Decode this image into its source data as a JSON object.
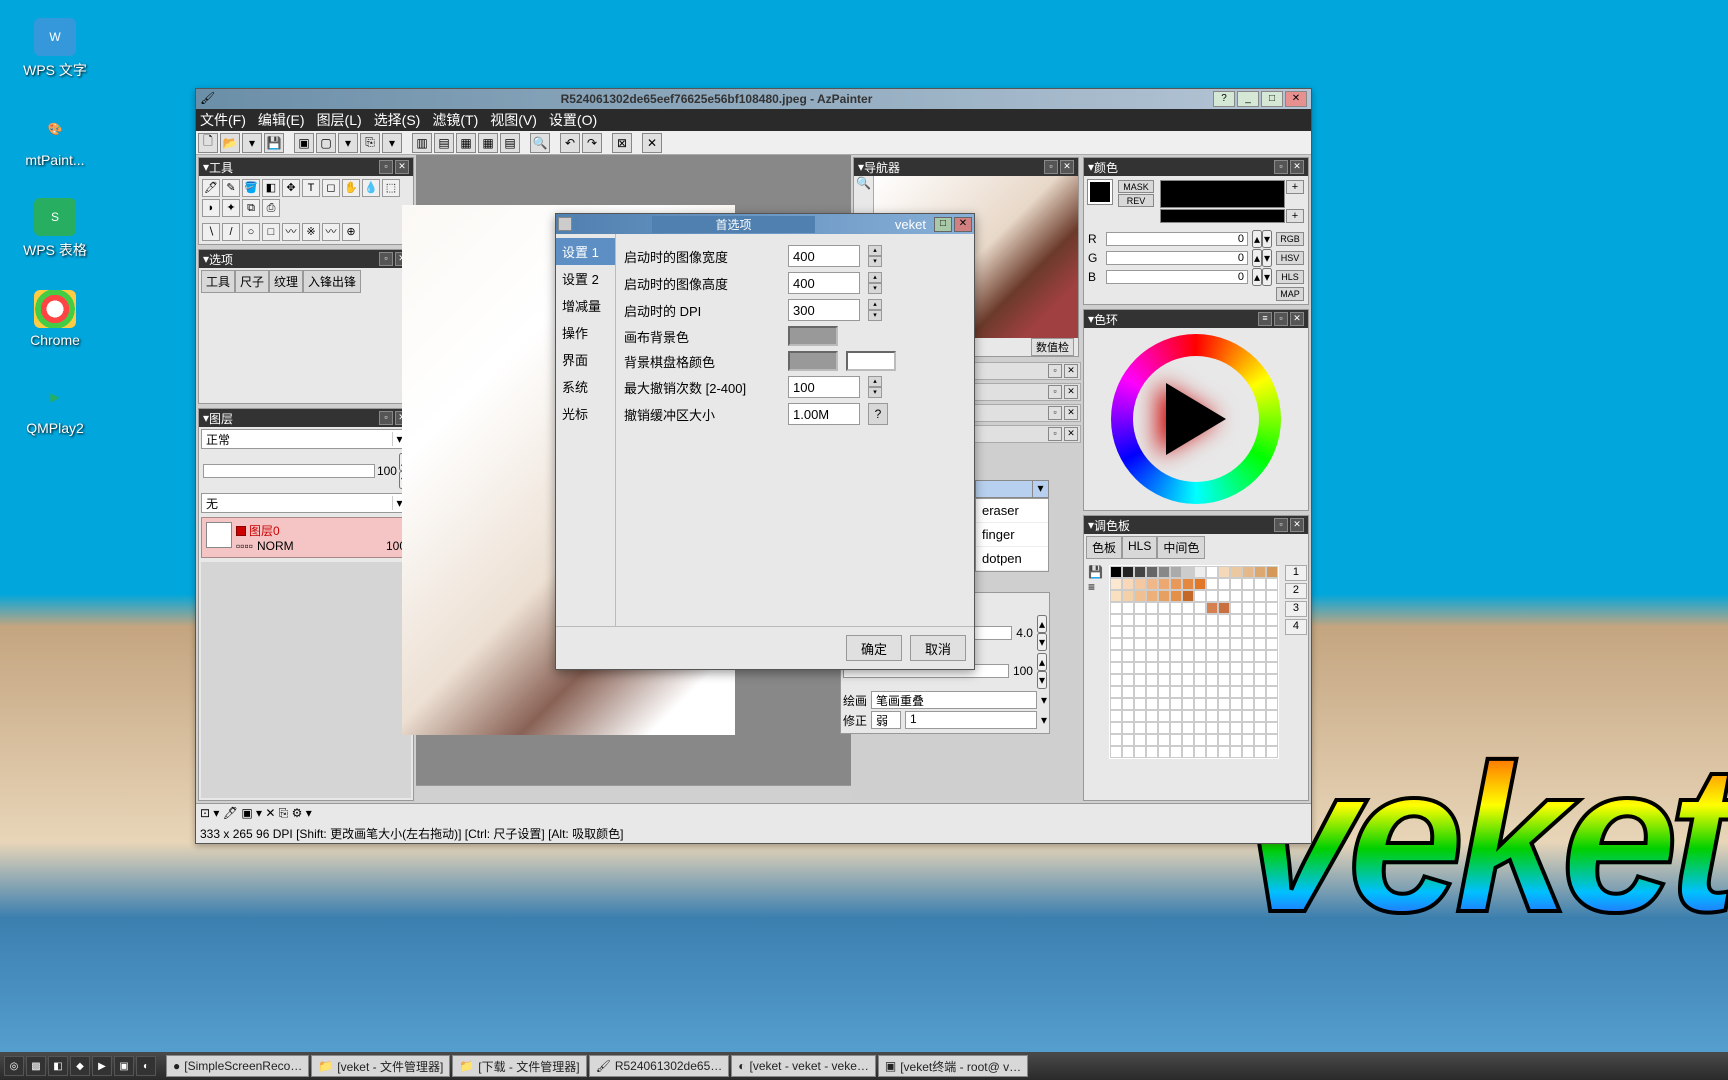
{
  "desktop": {
    "brand": "veket",
    "icons": [
      {
        "label": "WPS 文字",
        "icon": "W",
        "bg": "#3498db"
      },
      {
        "label": "mtPaint...",
        "icon": "🎨",
        "bg": "#333"
      },
      {
        "label": "WPS 表格",
        "icon": "S",
        "bg": "#27ae60"
      },
      {
        "label": "Chrome",
        "icon": "◐",
        "bg": "#fff"
      },
      {
        "label": "QMPlay2",
        "icon": "▶",
        "bg": "#27ae60"
      }
    ]
  },
  "window": {
    "title": "R524061302de65eef76625e56bf108480.jpeg - AzPainter",
    "menu": [
      "文件(F)",
      "编辑(E)",
      "图层(L)",
      "选择(S)",
      "滤镜(T)",
      "视图(V)",
      "设置(O)"
    ]
  },
  "panels": {
    "tools": "工具",
    "options": "选项",
    "option_tabs": [
      "工具",
      "尺子",
      "纹理",
      "入锋出锋"
    ],
    "layers": "图层",
    "layer_mode": "正常",
    "layer_mask": "无",
    "layer_opacity": "100",
    "layer0": {
      "name": "图层0",
      "norm": "NORM",
      "val": "100"
    },
    "nav": "导航器",
    "nav_btn": "数值检",
    "color": "颜色",
    "color_btns": [
      "MASK",
      "REV"
    ],
    "rgb": {
      "R": "0",
      "G": "0",
      "B": "0",
      "modes": [
        "RGB",
        "HSV",
        "HLS",
        "MAP"
      ]
    },
    "wheel": "色环",
    "palette": "调色板",
    "palette_tabs": [
      "色板",
      "HLS",
      "中间色"
    ],
    "palette_ids": [
      "1",
      "2",
      "3",
      "4"
    ]
  },
  "brush_list": [
    "eraser",
    "finger",
    "dotpen"
  ],
  "brush_settings": {
    "size_val": "4.0",
    "other_val": "100",
    "draw_label": "绘画",
    "draw_val": "笔画重叠",
    "fix_label": "修正",
    "fix_mode": "弱",
    "fix_val": "1"
  },
  "status": {
    "row1_icons": "",
    "row2": "333 x  265  96 DPI  [Shift: 更改画笔大小(左右拖动)]  [Ctrl: 尺子设置]  [Alt: 吸取颜色]"
  },
  "pref": {
    "title": "首选项",
    "brand": "veket",
    "tabs": [
      "设置 1",
      "设置 2",
      "增减量",
      "操作",
      "界面",
      "系统",
      "光标"
    ],
    "active_tab": "设置 1",
    "fields": {
      "width": {
        "label": "启动时的图像宽度",
        "value": "400"
      },
      "height": {
        "label": "启动时的图像高度",
        "value": "400"
      },
      "dpi": {
        "label": "启动时的 DPI",
        "value": "300"
      },
      "bg": {
        "label": "画布背景色"
      },
      "checker": {
        "label": "背景棋盘格颜色"
      },
      "undo": {
        "label": "最大撤销次数 [2-400]",
        "value": "100"
      },
      "undosize": {
        "label": "撤销缓冲区大小",
        "value": "1.00M"
      }
    },
    "ok": "确定",
    "cancel": "取消"
  },
  "taskbar": {
    "items": [
      "[SimpleScreenReco…",
      "[veket - 文件管理器]",
      "[下载 - 文件管理器]",
      "R524061302de65…",
      "[veket - veket - veke…",
      "[veket终端 - root@ v…"
    ]
  }
}
